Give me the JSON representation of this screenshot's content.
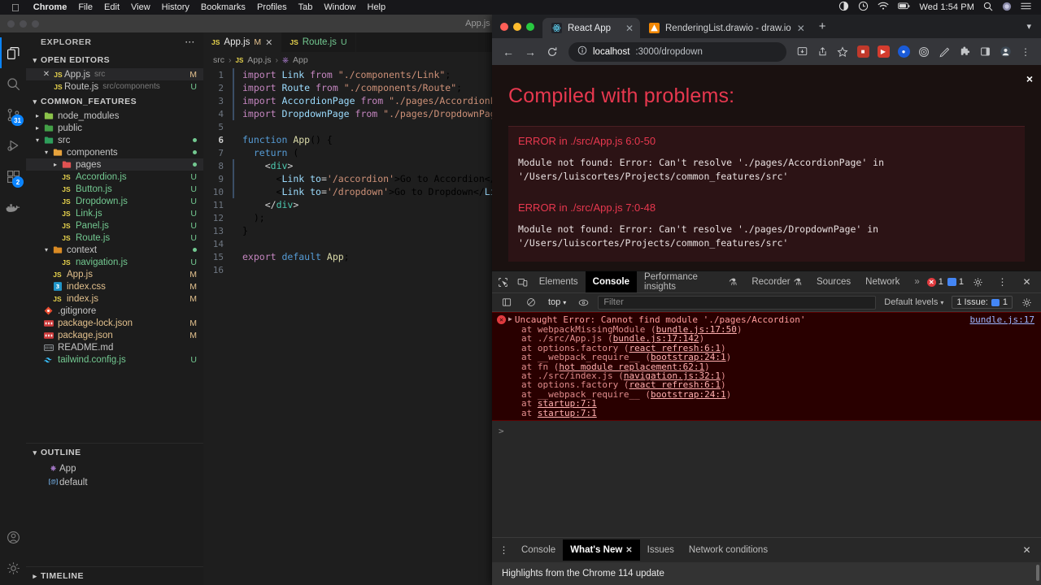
{
  "macbar": {
    "apple_icon": "apple-icon",
    "items": [
      "Chrome",
      "File",
      "Edit",
      "View",
      "History",
      "Bookmarks",
      "Profiles",
      "Tab",
      "Window",
      "Help"
    ],
    "clock": "Wed 1:54 PM",
    "right_icons": [
      "screen-share-icon",
      "time-machine-icon",
      "wifi-icon",
      "battery-icon",
      "search-icon",
      "siri-icon",
      "control-center-icon"
    ]
  },
  "vscode": {
    "window_title": "App.js — common_features",
    "activity_bar": [
      {
        "name": "explorer-icon",
        "badge": null,
        "active": true
      },
      {
        "name": "search-icon",
        "badge": null,
        "active": false
      },
      {
        "name": "source-control-icon",
        "badge": "31",
        "active": false
      },
      {
        "name": "run-and-debug-icon",
        "badge": null,
        "active": false
      },
      {
        "name": "extensions-icon",
        "badge": "2",
        "active": false
      },
      {
        "name": "docker-icon",
        "badge": null,
        "active": false
      }
    ],
    "activity_bottom": [
      {
        "name": "accounts-icon"
      },
      {
        "name": "settings-gear-icon"
      }
    ],
    "explorer": {
      "header": "EXPLORER",
      "header_more": "···",
      "open_editors": {
        "label": "OPEN EDITORS",
        "items": [
          {
            "name": "App.js",
            "sub": "src",
            "status": "M",
            "icon": "js-file-icon",
            "selected": true,
            "closable": true
          },
          {
            "name": "Route.js",
            "sub": "src/components",
            "status": "U",
            "icon": "js-file-icon",
            "selected": false,
            "closable": false
          }
        ]
      },
      "project": {
        "label": "COMMON_FEATURES",
        "items": [
          {
            "name": "node_modules",
            "type": "folder",
            "depth": 1,
            "expanded": false,
            "status": "",
            "icon": "folder-node-icon"
          },
          {
            "name": "public",
            "type": "folder",
            "depth": 1,
            "expanded": false,
            "status": "",
            "icon": "folder-public-icon"
          },
          {
            "name": "src",
            "type": "folder",
            "depth": 1,
            "expanded": true,
            "status": "dot",
            "icon": "folder-src-icon"
          },
          {
            "name": "components",
            "type": "folder",
            "depth": 2,
            "expanded": true,
            "status": "dot",
            "icon": "folder-components-icon"
          },
          {
            "name": "pages",
            "type": "folder",
            "depth": 3,
            "expanded": false,
            "status": "dot",
            "icon": "folder-pages-icon",
            "selected": true
          },
          {
            "name": "Accordion.js",
            "type": "file",
            "depth": 3,
            "status": "U",
            "icon": "js-file-icon"
          },
          {
            "name": "Button.js",
            "type": "file",
            "depth": 3,
            "status": "U",
            "icon": "js-file-icon"
          },
          {
            "name": "Dropdown.js",
            "type": "file",
            "depth": 3,
            "status": "U",
            "icon": "js-file-icon"
          },
          {
            "name": "Link.js",
            "type": "file",
            "depth": 3,
            "status": "U",
            "icon": "js-file-icon"
          },
          {
            "name": "Panel.js",
            "type": "file",
            "depth": 3,
            "status": "U",
            "icon": "js-file-icon"
          },
          {
            "name": "Route.js",
            "type": "file",
            "depth": 3,
            "status": "U",
            "icon": "js-file-icon"
          },
          {
            "name": "context",
            "type": "folder",
            "depth": 2,
            "expanded": true,
            "status": "dot",
            "icon": "folder-context-icon"
          },
          {
            "name": "navigation.js",
            "type": "file",
            "depth": 3,
            "status": "U",
            "icon": "js-file-icon"
          },
          {
            "name": "App.js",
            "type": "file",
            "depth": 2,
            "status": "M",
            "icon": "js-file-icon"
          },
          {
            "name": "index.css",
            "type": "file",
            "depth": 2,
            "status": "M",
            "icon": "css-file-icon"
          },
          {
            "name": "index.js",
            "type": "file",
            "depth": 2,
            "status": "M",
            "icon": "js-file-icon"
          },
          {
            "name": ".gitignore",
            "type": "file",
            "depth": 1,
            "status": "",
            "icon": "git-file-icon"
          },
          {
            "name": "package-lock.json",
            "type": "file",
            "depth": 1,
            "status": "M",
            "icon": "json-file-icon"
          },
          {
            "name": "package.json",
            "type": "file",
            "depth": 1,
            "status": "M",
            "icon": "json-file-icon"
          },
          {
            "name": "README.md",
            "type": "file",
            "depth": 1,
            "status": "",
            "icon": "markdown-file-icon"
          },
          {
            "name": "tailwind.config.js",
            "type": "file",
            "depth": 1,
            "status": "U",
            "icon": "tailwind-file-icon"
          }
        ]
      },
      "outline": {
        "label": "OUTLINE",
        "items": [
          {
            "name": "App",
            "icon": "symbol-function-icon"
          },
          {
            "name": "default",
            "icon": "symbol-variable-icon"
          }
        ]
      },
      "timeline": {
        "label": "TIMELINE"
      }
    },
    "editor": {
      "tabs": [
        {
          "label": "App.js",
          "status": "M",
          "icon": "js-file-icon",
          "active": true,
          "closable": true
        },
        {
          "label": "Route.js",
          "status": "U",
          "icon": "js-file-icon",
          "active": false,
          "closable": false
        }
      ],
      "breadcrumb": [
        "src",
        "App.js",
        "App"
      ],
      "lines": [
        {
          "n": "1",
          "modified": true
        },
        {
          "n": "2",
          "modified": true
        },
        {
          "n": "3",
          "modified": true
        },
        {
          "n": "4",
          "modified": true
        },
        {
          "n": "5",
          "modified": false
        },
        {
          "n": "6",
          "modified": false,
          "current": true
        },
        {
          "n": "7",
          "modified": false
        },
        {
          "n": "8",
          "modified": true
        },
        {
          "n": "9",
          "modified": true
        },
        {
          "n": "10",
          "modified": true
        },
        {
          "n": "11",
          "modified": false
        },
        {
          "n": "12",
          "modified": false
        },
        {
          "n": "13",
          "modified": false
        },
        {
          "n": "14",
          "modified": false
        },
        {
          "n": "15",
          "modified": false
        },
        {
          "n": "16",
          "modified": false
        }
      ],
      "source_text": [
        "import Link from \"./components/Link\";",
        "import Route from \"./components/Route\";",
        "import AccordionPage from \"./pages/AccordionPage\";",
        "import DropdownPage from \"./pages/DropdownPage\";",
        "",
        "function App() {",
        "  return (",
        "    <div>",
        "      <Link to='/accordion'>Go to Accordion</Link>",
        "      <Link to='/dropdown'>Go to Dropdown</Link>",
        "    </div>",
        "  );",
        "}",
        "",
        "export default App;",
        ""
      ]
    }
  },
  "chrome": {
    "tabs": [
      {
        "label": "React App",
        "active": true,
        "favicon": "react-icon",
        "closable": true
      },
      {
        "label": "RenderingList.drawio - draw.io",
        "active": false,
        "favicon": "drawio-icon",
        "closable": true
      }
    ],
    "new_tab_label": "+",
    "tab_list_chevron": "chevron-down-icon",
    "toolbar": {
      "back": "back-arrow-icon",
      "forward": "forward-arrow-icon",
      "reload": "reload-icon",
      "site_info": "info-circle-icon",
      "url_host": "localhost",
      "url_rest": ":3000/dropdown",
      "right_icons": [
        "install-app-icon",
        "share-icon",
        "bookmark-star-icon",
        "extension-red-icon",
        "extension-redvideo-icon",
        "extension-blue-icon",
        "extension-target-icon",
        "extension-pen-icon",
        "extensions-puzzle-icon",
        "side-panel-icon",
        "profile-avatar-icon",
        "chrome-menu-icon"
      ]
    },
    "page": {
      "close_overlay": "×",
      "title": "Compiled with problems:",
      "errors": [
        {
          "heading": "ERROR in ./src/App.js 6:0-50",
          "lines": [
            "Module not found: Error: Can't resolve './pages/AccordionPage' in",
            "'/Users/luiscortes/Projects/common_features/src'"
          ]
        },
        {
          "heading": "ERROR in ./src/App.js 7:0-48",
          "lines": [
            "Module not found: Error: Can't resolve './pages/DropdownPage' in",
            "'/Users/luiscortes/Projects/common_features/src'"
          ]
        }
      ]
    },
    "devtools": {
      "left_icons": [
        "inspect-element-icon",
        "device-toolbar-icon"
      ],
      "tabs": [
        {
          "label": "Elements",
          "active": false
        },
        {
          "label": "Console",
          "active": true
        },
        {
          "label": "Performance insights",
          "active": false,
          "beta": "⚗"
        },
        {
          "label": "Recorder",
          "active": false,
          "beta": "⚗"
        },
        {
          "label": "Sources",
          "active": false
        },
        {
          "label": "Network",
          "active": false
        }
      ],
      "overflow": "»",
      "error_count": "1",
      "warning_count": "1",
      "settings_icon": "gear-icon",
      "more_icon": "kebab-menu-icon",
      "close_icon": "close-icon",
      "filterbar": {
        "sidebar_icon": "console-sidebar-icon",
        "clear_icon": "clear-console-icon",
        "context": "top",
        "eye_icon": "live-expression-icon",
        "filter_placeholder": "Filter",
        "levels": "Default levels",
        "issues_text": "1 Issue:",
        "issues_count": "1",
        "settings_icon": "gear-icon"
      },
      "console": {
        "error_message": "Uncaught Error: Cannot find module './pages/Accordion'",
        "source_link": "bundle.js:17",
        "stack": [
          {
            "pre": "    at webpackMissingModule (",
            "link": "bundle.js:17:50",
            "post": ")"
          },
          {
            "pre": "    at ./src/App.js (",
            "link": "bundle.js:17:142",
            "post": ")"
          },
          {
            "pre": "    at options.factory (",
            "link": "react refresh:6:1",
            "post": ")"
          },
          {
            "pre": "    at __webpack_require__ (",
            "link": "bootstrap:24:1",
            "post": ")"
          },
          {
            "pre": "    at fn (",
            "link": "hot module replacement:62:1",
            "post": ")"
          },
          {
            "pre": "    at ./src/index.js (",
            "link": "navigation.js:32:1",
            "post": ")"
          },
          {
            "pre": "    at options.factory (",
            "link": "react refresh:6:1",
            "post": ")"
          },
          {
            "pre": "    at __webpack_require__ (",
            "link": "bootstrap:24:1",
            "post": ")"
          },
          {
            "pre": "    at ",
            "link": "startup:7:1",
            "post": ""
          },
          {
            "pre": "    at ",
            "link": "startup:7:1",
            "post": ""
          }
        ],
        "prompt_symbol": ">"
      },
      "drawer": {
        "more_icon": "kebab-menu-icon",
        "tabs": [
          {
            "label": "Console",
            "active": false,
            "closable": false
          },
          {
            "label": "What's New",
            "active": true,
            "closable": true
          },
          {
            "label": "Issues",
            "active": false,
            "closable": false
          },
          {
            "label": "Network conditions",
            "active": false,
            "closable": false
          }
        ],
        "close_icon": "close-icon",
        "content_text": "Highlights from the Chrome 114 update"
      }
    }
  },
  "colors": {
    "accent_blue": "#0a84ff",
    "error_red": "#e8384f",
    "vscode_bg": "#1e1e1e",
    "chrome_bg": "#202124",
    "modified_amber": "#e2c08d",
    "untracked_green": "#73c991"
  }
}
